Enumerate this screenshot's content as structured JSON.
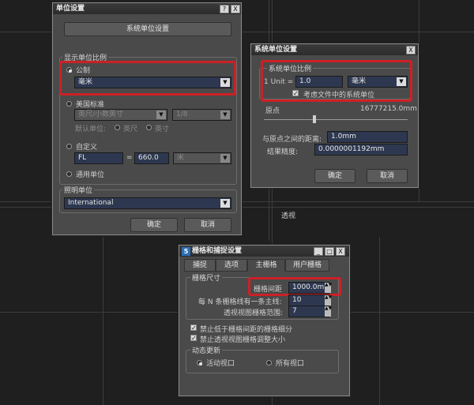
{
  "background": {
    "viewport_label": "透视"
  },
  "units_dialog": {
    "title": "单位设置",
    "help_btn": "?",
    "close_btn": "X",
    "system_units_btn": "系统单位设置",
    "display_scale_group": "显示单位比例",
    "metric_label": "公制",
    "metric_value": "毫米",
    "us_label": "美国标准",
    "us_value": "英尺/小数英寸",
    "us_fraction": "1/8",
    "default_units_label": "默认单位:",
    "feet_label": "英尺",
    "inches_label": "英寸",
    "custom_label": "自定义",
    "custom_name": "FL",
    "custom_eq": "=",
    "custom_value": "660.0",
    "custom_unit": "米",
    "generic_label": "通用单位",
    "lighting_group": "照明单位",
    "lighting_value": "International",
    "ok": "确定",
    "cancel": "取消"
  },
  "system_dialog": {
    "title": "系统单位设置",
    "close_btn": "X",
    "scale_group": "系统单位比例",
    "unit_prefix": "1 Unit =",
    "unit_value": "1.0",
    "unit_select": "毫米",
    "respect_checkbox": "考虑文件中的系统单位",
    "origin_label": "原点",
    "origin_value": "16777215.0mm",
    "distance_label": "与原点之间的距离:",
    "distance_value": "1.0mm",
    "precision_label": "结果精度:",
    "precision_value": "0.0000001192mm",
    "ok": "确定",
    "cancel": "取消"
  },
  "grid_dialog": {
    "title": "栅格和捕捉设置",
    "icon_text": "5",
    "tabs": [
      "捕捉",
      "选项",
      "主栅格",
      "用户栅格"
    ],
    "grid_size_group": "栅格尺寸",
    "spacing_label": "栅格间距",
    "spacing_value": "1000.0m",
    "major_label": "每 N 条栅格线有一条主线:",
    "major_value": "10",
    "extent_label": "透视视图栅格范围:",
    "extent_value": "7",
    "inhibit_check": "禁止低于栅格间距的栅格细分",
    "perspective_check": "禁止透视视图栅格调整大小",
    "dynamic_group": "动态更新",
    "active_viewport": "活动视口",
    "all_viewports": "所有视口"
  },
  "colors": {
    "highlight": "#cc2026",
    "field": "#2d3850",
    "dialog": "#4a4a4a"
  }
}
